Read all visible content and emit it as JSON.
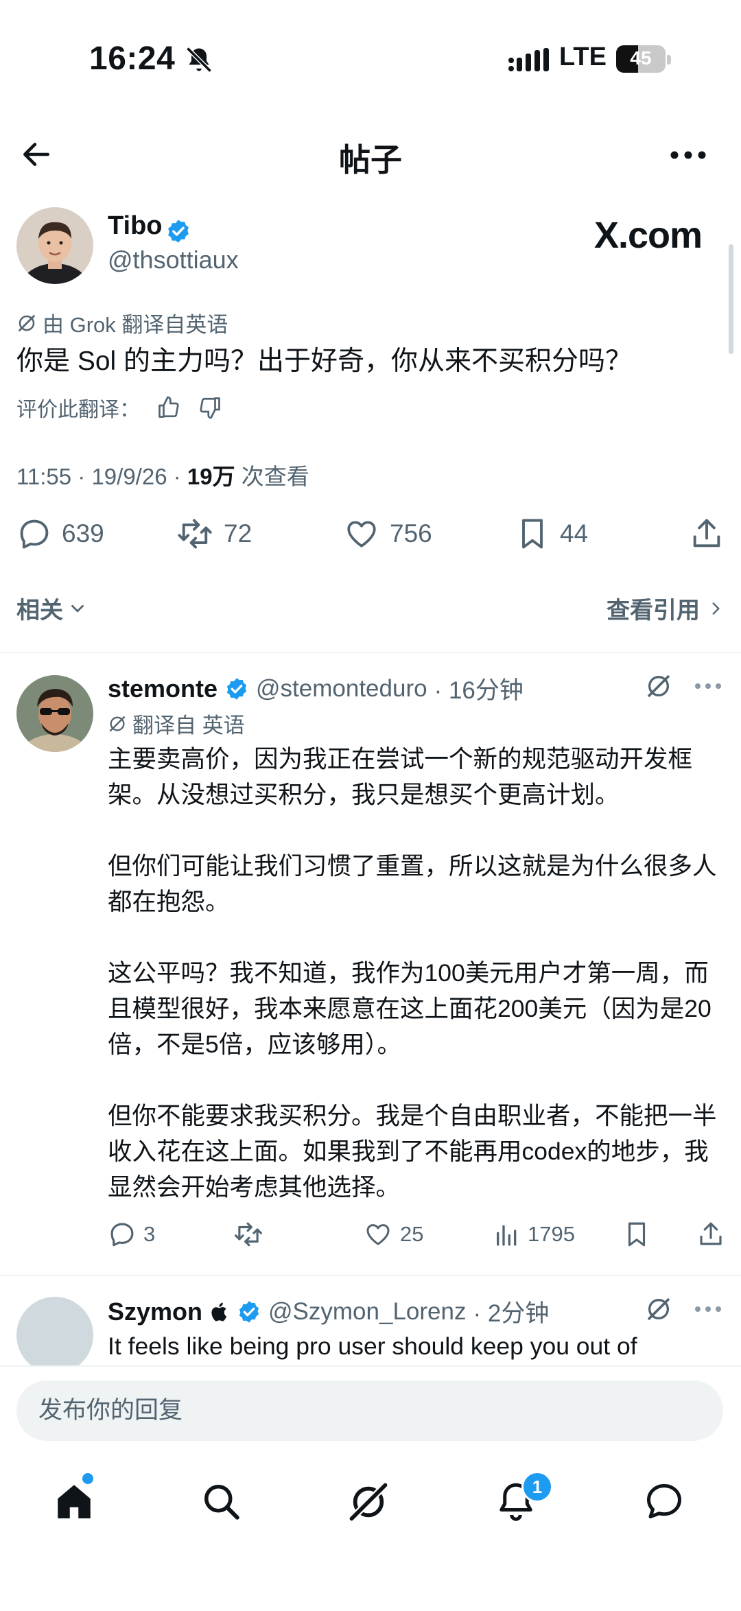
{
  "status_bar": {
    "time": "16:24",
    "network": "LTE",
    "battery": "45",
    "battery_level": 0.45
  },
  "header": {
    "title": "帖子"
  },
  "post": {
    "author_name": "Tibo",
    "handle": "@thsottiaux",
    "watermark": "X.com",
    "translation_note": "由 Grok 翻译自英语",
    "text": "你是 Sol 的主力吗？出于好奇，你从来不买积分吗？",
    "rate_label": "评价此翻译：",
    "time_date": "11:55 · 19/9/26 · ",
    "views_count": "19万",
    "views_label": " 次查看",
    "replies": "639",
    "reposts": "72",
    "likes": "756",
    "bookmarks": "44"
  },
  "related": {
    "label": "相关",
    "quotes_label": "查看引用"
  },
  "replies": [
    {
      "name": "stemonte",
      "handle": "@stemonteduro",
      "time": "· 16分钟",
      "translation_note": "翻译自 英语",
      "paragraphs": [
        "主要卖高价，因为我正在尝试一个新的规范驱动开发框架。从没想过买积分，我只是想买个更高计划。",
        "但你们可能让我们习惯了重置，所以这就是为什么很多人都在抱怨。",
        "这公平吗？我不知道，我作为100美元用户才第一周，而且模型很好，我本来愿意在这上面花200美元（因为是20倍，不是5倍，应该够用）。",
        "但你不能要求我买积分。我是个自由职业者，不能把一半收入花在这上面。如果我到了不能再用codex的地步，我显然会开始考虑其他选择。"
      ],
      "replies": "3",
      "likes": "25",
      "views": "1795"
    },
    {
      "name": "Szymon",
      "handle": "@Szymon_Lorenz",
      "time": "· 2分钟",
      "text": "It feels like being pro user should keep you out of"
    }
  ],
  "compose": {
    "placeholder": "发布你的回复"
  },
  "tab_bar": {
    "notifications_badge": "1"
  },
  "colors": {
    "accent": "#1d9bf0",
    "text": "#0f1419",
    "secondary": "#536471",
    "divider": "#eff3f4"
  }
}
